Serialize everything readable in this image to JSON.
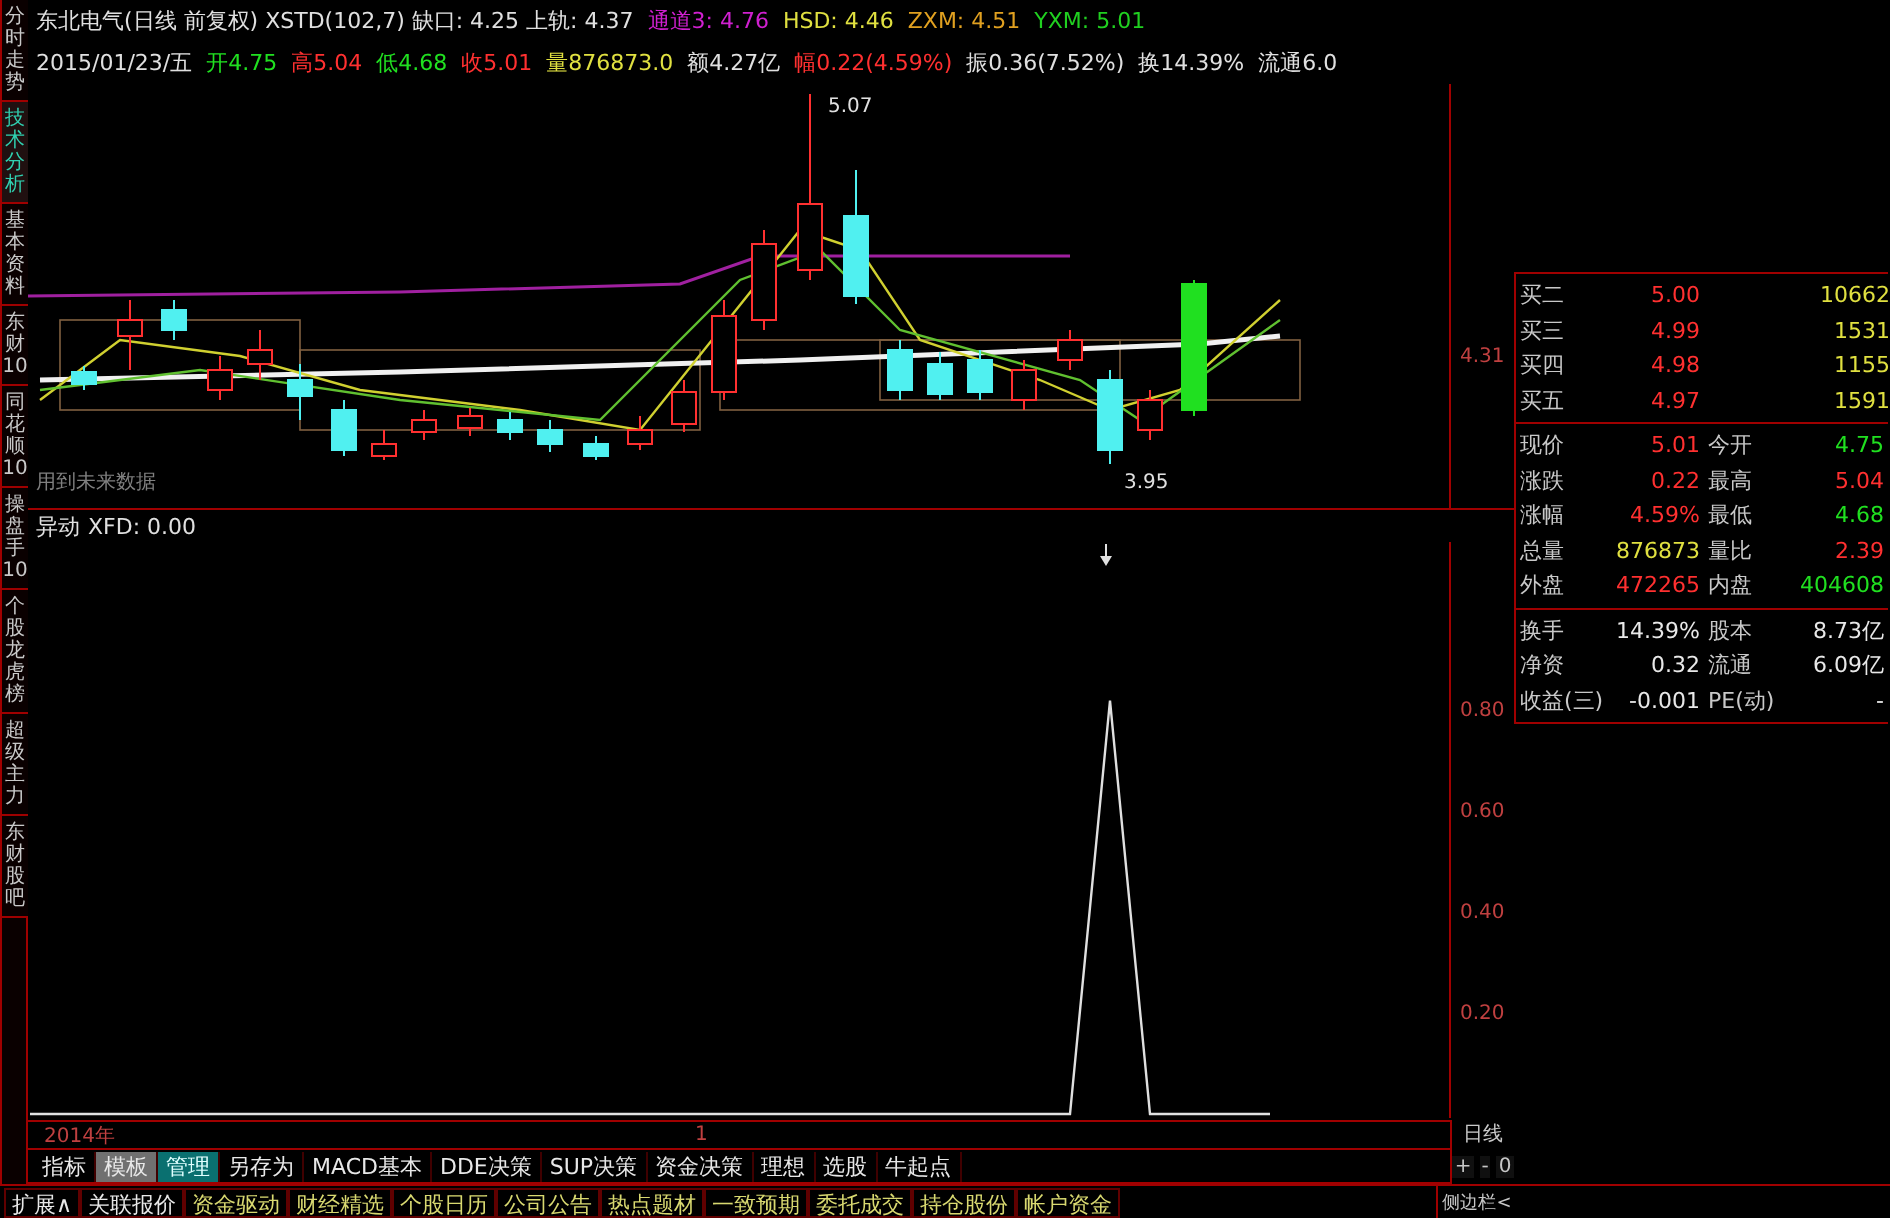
{
  "side_tabs": [
    {
      "label": "分时走势",
      "selected": false
    },
    {
      "label": "技术分析",
      "selected": true
    },
    {
      "label": "基本资料",
      "selected": false
    },
    {
      "label": "东财10",
      "selected": false
    },
    {
      "label": "同花顺10",
      "selected": false
    },
    {
      "label": "操盘手10",
      "selected": false
    },
    {
      "label": "个股龙虎榜",
      "selected": false
    },
    {
      "label": "超级主力",
      "selected": false
    },
    {
      "label": "东财股吧",
      "selected": false
    }
  ],
  "price_pane": {
    "title_items": [
      {
        "text": "东北电气(日线 前复权) XSTD(102,7) 缺口: 4.25 上轨: 4.37",
        "color": "#e0e0e0"
      },
      {
        "text": "通道3: 4.76",
        "color": "#d020d0"
      },
      {
        "text": "HSD: 4.46",
        "color": "#e0e040"
      },
      {
        "text": "ZXM: 4.51",
        "color": "#e0a020"
      },
      {
        "text": "YXM: 5.01",
        "color": "#20d020"
      }
    ],
    "quote_items": [
      {
        "text": "2015/01/23/五",
        "color": "#e0e0e0"
      },
      {
        "text": "开4.75",
        "color": "#20e020"
      },
      {
        "text": "高5.04",
        "color": "#ff3030"
      },
      {
        "text": "低4.68",
        "color": "#20e020"
      },
      {
        "text": "收5.01",
        "color": "#ff3030"
      },
      {
        "text": "量876873.0",
        "color": "#e0e040"
      },
      {
        "text": "额4.27亿",
        "color": "#e0e0e0"
      },
      {
        "text": "幅0.22(4.59%)",
        "color": "#ff3030"
      },
      {
        "text": "振0.36(7.52%)",
        "color": "#e0e0e0"
      },
      {
        "text": "换14.39%",
        "color": "#e0e0e0"
      },
      {
        "text": "流通6.0",
        "color": "#e0e0e0"
      }
    ],
    "high_label": "5.07",
    "low_label": "3.95",
    "price_axis_label": "4.31",
    "notice": "用到未来数据"
  },
  "indicator_pane": {
    "title": "异动",
    "reading": "XFD: 0.00",
    "axis_labels": [
      "0.80",
      "0.60",
      "0.40",
      "0.20"
    ]
  },
  "time_axis": [
    "2014年",
    "1"
  ],
  "period": "日线",
  "order_book": [
    {
      "label": "买二",
      "price": "5.00",
      "volume": "10662"
    },
    {
      "label": "买三",
      "price": "4.99",
      "volume": "1531"
    },
    {
      "label": "买四",
      "price": "4.98",
      "volume": "1155"
    },
    {
      "label": "买五",
      "price": "4.97",
      "volume": "1591"
    }
  ],
  "quotes": [
    {
      "label": "现价",
      "value": "5.01",
      "color": "#ff3030"
    },
    {
      "label": "今开",
      "value": "4.75",
      "color": "#20e020"
    },
    {
      "label": "涨跌",
      "value": "0.22",
      "color": "#ff3030"
    },
    {
      "label": "最高",
      "value": "5.04",
      "color": "#ff3030"
    },
    {
      "label": "涨幅",
      "value": "4.59%",
      "color": "#ff3030"
    },
    {
      "label": "最低",
      "value": "4.68",
      "color": "#20e020"
    },
    {
      "label": "总量",
      "value": "876873",
      "color": "#e0e040"
    },
    {
      "label": "量比",
      "value": "2.39",
      "color": "#ff3030"
    },
    {
      "label": "外盘",
      "value": "472265",
      "color": "#ff3030"
    },
    {
      "label": "内盘",
      "value": "404608",
      "color": "#20e020"
    }
  ],
  "fundamentals": [
    {
      "label": "换手",
      "value": "14.39%"
    },
    {
      "label": "股本",
      "value": "8.73亿"
    },
    {
      "label": "净资",
      "value": "0.32"
    },
    {
      "label": "流通",
      "value": "6.09亿"
    },
    {
      "label": "收益(三)",
      "value": "-0.001"
    },
    {
      "label": "PE(动)",
      "value": "-"
    }
  ],
  "indicator_toolbar": [
    {
      "label": "指标",
      "selected": false,
      "kind": "plain"
    },
    {
      "label": "模板",
      "selected": true,
      "kind": "plain"
    },
    {
      "label": "管理",
      "selected": false,
      "kind": "accent"
    },
    {
      "label": "另存为",
      "selected": false,
      "kind": "plain"
    },
    {
      "label": "MACD基本",
      "selected": false,
      "kind": "plain"
    },
    {
      "label": "DDE决策",
      "selected": false,
      "kind": "plain"
    },
    {
      "label": "SUP决策",
      "selected": false,
      "kind": "plain"
    },
    {
      "label": "资金决策",
      "selected": false,
      "kind": "plain"
    },
    {
      "label": "理想",
      "selected": false,
      "kind": "plain"
    },
    {
      "label": "选股",
      "selected": false,
      "kind": "plain"
    },
    {
      "label": "牛起点",
      "selected": false,
      "kind": "plain"
    }
  ],
  "zoom_controls": [
    "+",
    "-",
    "0"
  ],
  "bottom_nav": [
    {
      "label": "扩展∧",
      "kind": "plain"
    },
    {
      "label": "关联报价",
      "kind": "plain"
    },
    {
      "label": "资金驱动",
      "kind": "link"
    },
    {
      "label": "财经精选",
      "kind": "link"
    },
    {
      "label": "个股日历",
      "kind": "link"
    },
    {
      "label": "公司公告",
      "kind": "link"
    },
    {
      "label": "热点题材",
      "kind": "link"
    },
    {
      "label": "一致预期",
      "kind": "link"
    },
    {
      "label": "委托成交",
      "kind": "link"
    },
    {
      "label": "持仓股份",
      "kind": "link"
    },
    {
      "label": "帐户资金",
      "kind": "link"
    }
  ],
  "sidebar_toggle": "侧边栏<"
}
